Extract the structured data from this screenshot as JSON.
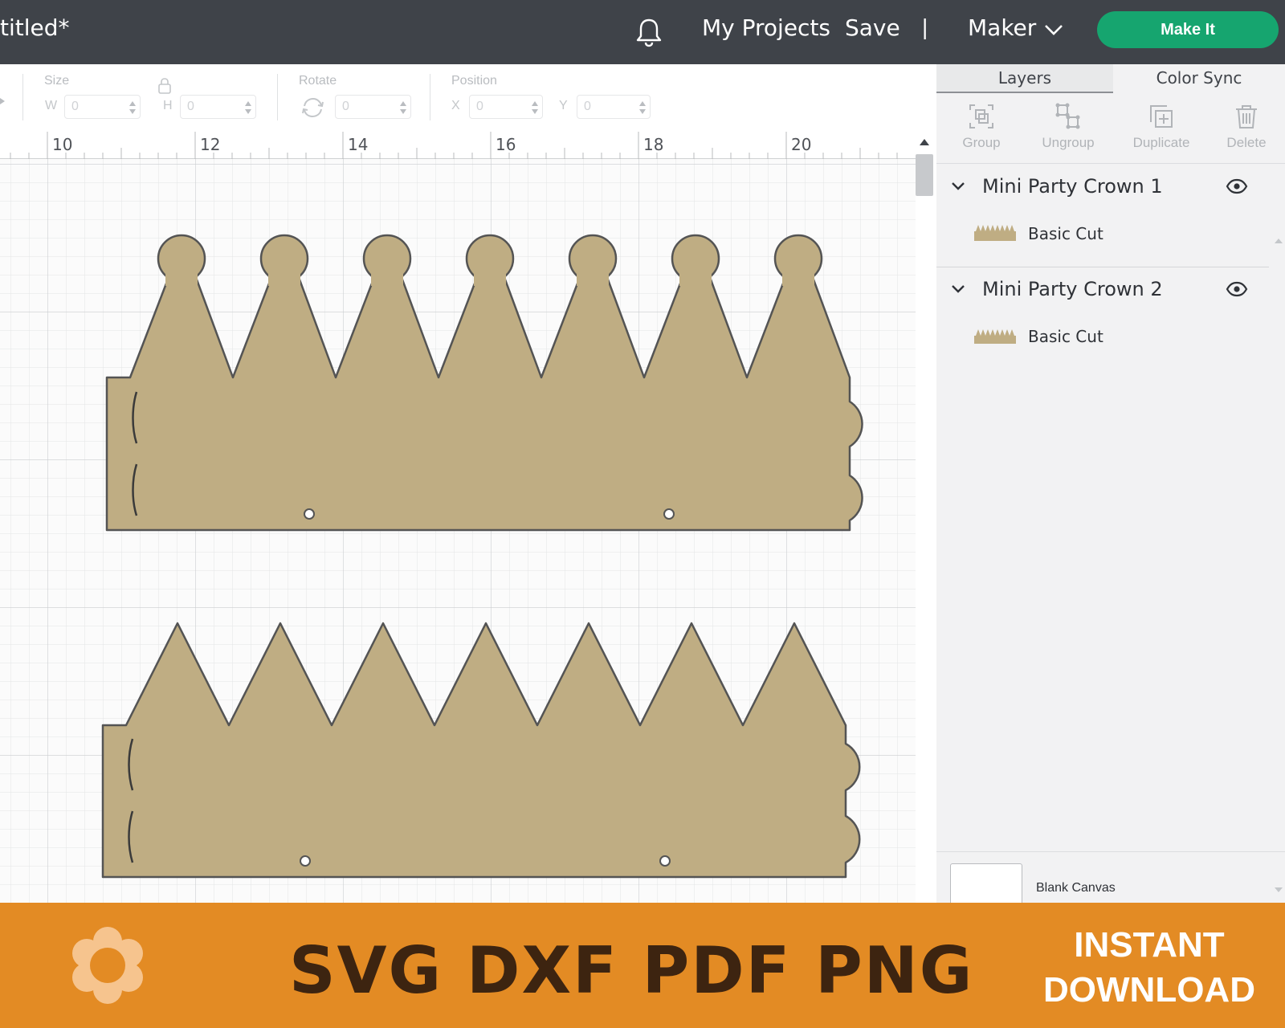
{
  "app": {
    "doc_title": "titled*",
    "nav": {
      "projects": "My Projects",
      "save": "Save",
      "separator": "|",
      "machine": "Maker",
      "make_it": "Make It"
    }
  },
  "toolbar": {
    "size_label": "Size",
    "w_label": "W",
    "w_value": "0",
    "h_label": "H",
    "h_value": "0",
    "rotate_label": "Rotate",
    "rotate_value": "0",
    "position_label": "Position",
    "x_label": "X",
    "x_value": "0",
    "y_label": "Y",
    "y_value": "0"
  },
  "ruler": {
    "labels": [
      "10",
      "12",
      "14",
      "16",
      "18",
      "20"
    ]
  },
  "panel": {
    "tabs": [
      {
        "label": "Layers",
        "active": true
      },
      {
        "label": "Color Sync",
        "active": false
      }
    ],
    "tools": [
      {
        "label": "Group",
        "icon": "group-icon"
      },
      {
        "label": "Ungroup",
        "icon": "ungroup-icon"
      },
      {
        "label": "Duplicate",
        "icon": "duplicate-icon"
      },
      {
        "label": "Delete",
        "icon": "trash-icon"
      }
    ],
    "layers": [
      {
        "name": "Mini Party Crown 1",
        "operation": "Basic Cut",
        "icon": "eye-icon"
      },
      {
        "name": "Mini Party Crown 2",
        "operation": "Basic Cut",
        "icon": "eye-icon"
      }
    ],
    "blank_canvas": "Blank Canvas"
  },
  "colors": {
    "topbar": "#3f4349",
    "make_it": "#16a56f",
    "crown_fill": "#bfad83",
    "crown_stroke": "#545454",
    "banner": "#e38b24",
    "banner_text": "#3d2410",
    "flower": "#f6c48e"
  },
  "banner": {
    "formats": "SVG DXF PDF PNG",
    "cta_line1": "INSTANT",
    "cta_line2": "DOWNLOAD"
  }
}
